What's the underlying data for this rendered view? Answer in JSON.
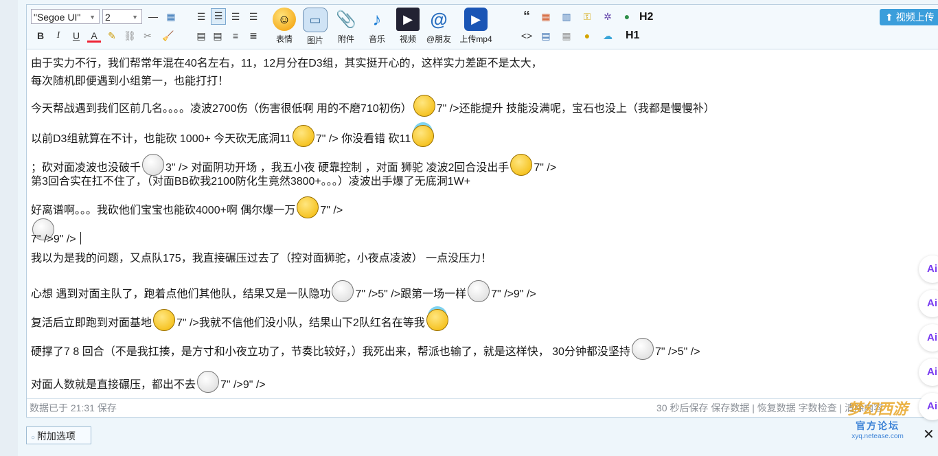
{
  "toolbar": {
    "font_family": "\"Segoe UI\"",
    "font_size": "2",
    "format_row1": [
      "—",
      "▦"
    ],
    "format_row2": [
      "B",
      "I",
      "U",
      "A"
    ],
    "media": [
      {
        "name": "emoji",
        "label": "表情"
      },
      {
        "name": "image",
        "label": "图片"
      },
      {
        "name": "attachment",
        "label": "附件"
      },
      {
        "name": "music",
        "label": "音乐"
      },
      {
        "name": "video",
        "label": "视频"
      },
      {
        "name": "at-friend",
        "label": "@朋友"
      },
      {
        "name": "upload-mp4",
        "label": "上传mp4"
      }
    ],
    "h1": "H1",
    "h2": "H2",
    "quote": "“",
    "code": "<>",
    "video_upload": "视频上传"
  },
  "content": {
    "lines": [
      {
        "parts": [
          {
            "t": "由于实力不行，我们帮常年混在40名左右，11，12月分在D3组，其实挺开心的，这样实力差距不是太大，"
          }
        ]
      },
      {
        "parts": [
          {
            "t": "每次随机即便遇到小组第一，也能打打！"
          }
        ]
      },
      {
        "parts": [
          {
            "t": "今天帮战遇到我们区前几名。。。。凌波2700伤（伤害很低啊 用的不磨710初伤）"
          },
          {
            "e": "yellow"
          },
          {
            "t": "7\" />还能提升 技能没满呢，宝石也没上（我都是慢慢补）"
          }
        ]
      },
      {
        "parts": [
          {
            "t": "以前D3组就算在不计，也能砍 1000+  今天砍无底洞11"
          },
          {
            "e": "yellow"
          },
          {
            "t": "7\" /> 你没看错 砍11"
          },
          {
            "e": "halo"
          }
        ]
      },
      {
        "parts": [
          {
            "t": "；砍对面凌波也没破千"
          },
          {
            "e": "white"
          },
          {
            "t": "3\" /> 对面阴功开场 ，我五小夜 硬靠控制 ，对面 狮驼 凌波2回合没出手"
          },
          {
            "e": "yellow"
          },
          {
            "t": "7\" />"
          }
        ]
      },
      {
        "parts": [
          {
            "t": "第3回合实在扛不住了，（对面BB砍我2100防化生竟然3800+。。。）凌波出手爆了无底洞1W+"
          }
        ]
      },
      {
        "parts": [
          {
            "t": "好离谱啊。。。我砍他们宝宝也能砍4000+啊 偶尔爆一万"
          },
          {
            "e": "yellow"
          },
          {
            "t": "7\" />"
          }
        ]
      },
      {
        "parts": [
          {
            "e": "white"
          }
        ]
      },
      {
        "parts": [
          {
            "t": "7\" />9\" />"
          },
          {
            "c": true
          }
        ]
      },
      {
        "parts": [
          {
            "t": "我以为是我的问题，又点队175，我直接碾压过去了（控对面狮驼，小夜点凌波） 一点没压力！"
          }
        ]
      },
      {
        "parts": [
          {
            "t": "心想 遇到对面主队了，跑着点他们其他队，结果又是一队隐功"
          },
          {
            "e": "white"
          },
          {
            "t": "7\" />5\" />跟第一场一样"
          },
          {
            "e": "white"
          },
          {
            "t": "7\" />9\" />"
          }
        ]
      },
      {
        "parts": [
          {
            "t": "复活后立即跑到对面基地"
          },
          {
            "e": "yellow"
          },
          {
            "t": "7\" />我就不信他们没小队，结果山下2队红名在等我"
          },
          {
            "e": "halo"
          }
        ]
      },
      {
        "parts": [
          {
            "t": "硬撑了7 8 回合（不是我扛揍，是方寸和小夜立功了，节奏比较好，）我死出来，帮派也输了，就是这样快， 30分钟都没坚持"
          },
          {
            "e": "white"
          },
          {
            "t": "7\" />5\" />"
          }
        ]
      },
      {
        "parts": [
          {
            "t": "对面人数就是直接碾压，都出不去"
          },
          {
            "e": "white"
          },
          {
            "t": "7\" />9\" />"
          }
        ]
      }
    ]
  },
  "status": {
    "saved": "数据已于 21:31 保存",
    "right": "30 秒后保存 保存数据 | 恢复数据    字数检查 | 清除内容"
  },
  "extra_options": "附加选项",
  "ai_label": "Ai",
  "watermark": {
    "brand": "梦幻西游",
    "forum": "官方论坛",
    "url": "xyq.netease.com"
  }
}
